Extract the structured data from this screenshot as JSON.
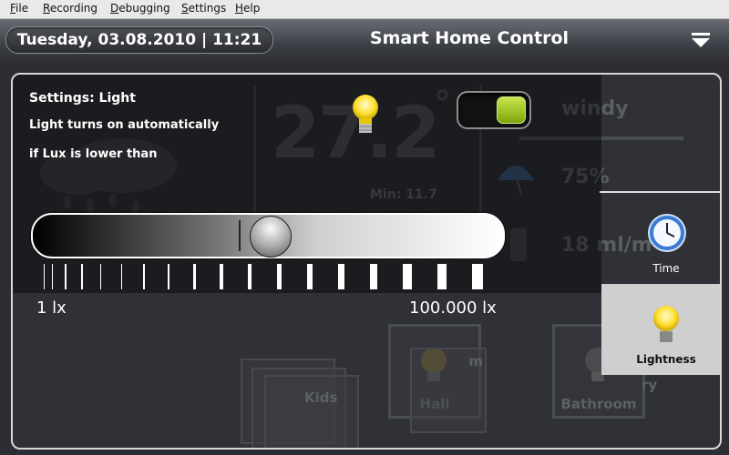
{
  "menu": [
    "File",
    "Recording",
    "Debugging",
    "Settings",
    "Help"
  ],
  "header": {
    "datetime": "Tuesday, 03.08.2010 | 11:21",
    "title": "Smart Home Control"
  },
  "background": {
    "temperature": "27.2",
    "degree": "°",
    "min": "Min: 11.7",
    "wind": "windy",
    "humidity": "75%",
    "rain": "18 ml/m",
    "rooms": [
      "Hall",
      "Bathroom"
    ],
    "room_partial": [
      "Kids",
      "m",
      "ry"
    ]
  },
  "settings": {
    "title": "Settings: Light",
    "line1": "Light turns on automatically",
    "line2": "if Lux is lower than",
    "toggle_on": true,
    "slider_value": 0.45,
    "scale_min": "1 lx",
    "scale_max": "100.000 lx"
  },
  "sidebar": {
    "time_label": "Time",
    "lightness_label": "Lightness"
  },
  "colors": {
    "toggle_on": "#8fba1a",
    "accent": "#ffffff",
    "panel": "#2f3136"
  }
}
